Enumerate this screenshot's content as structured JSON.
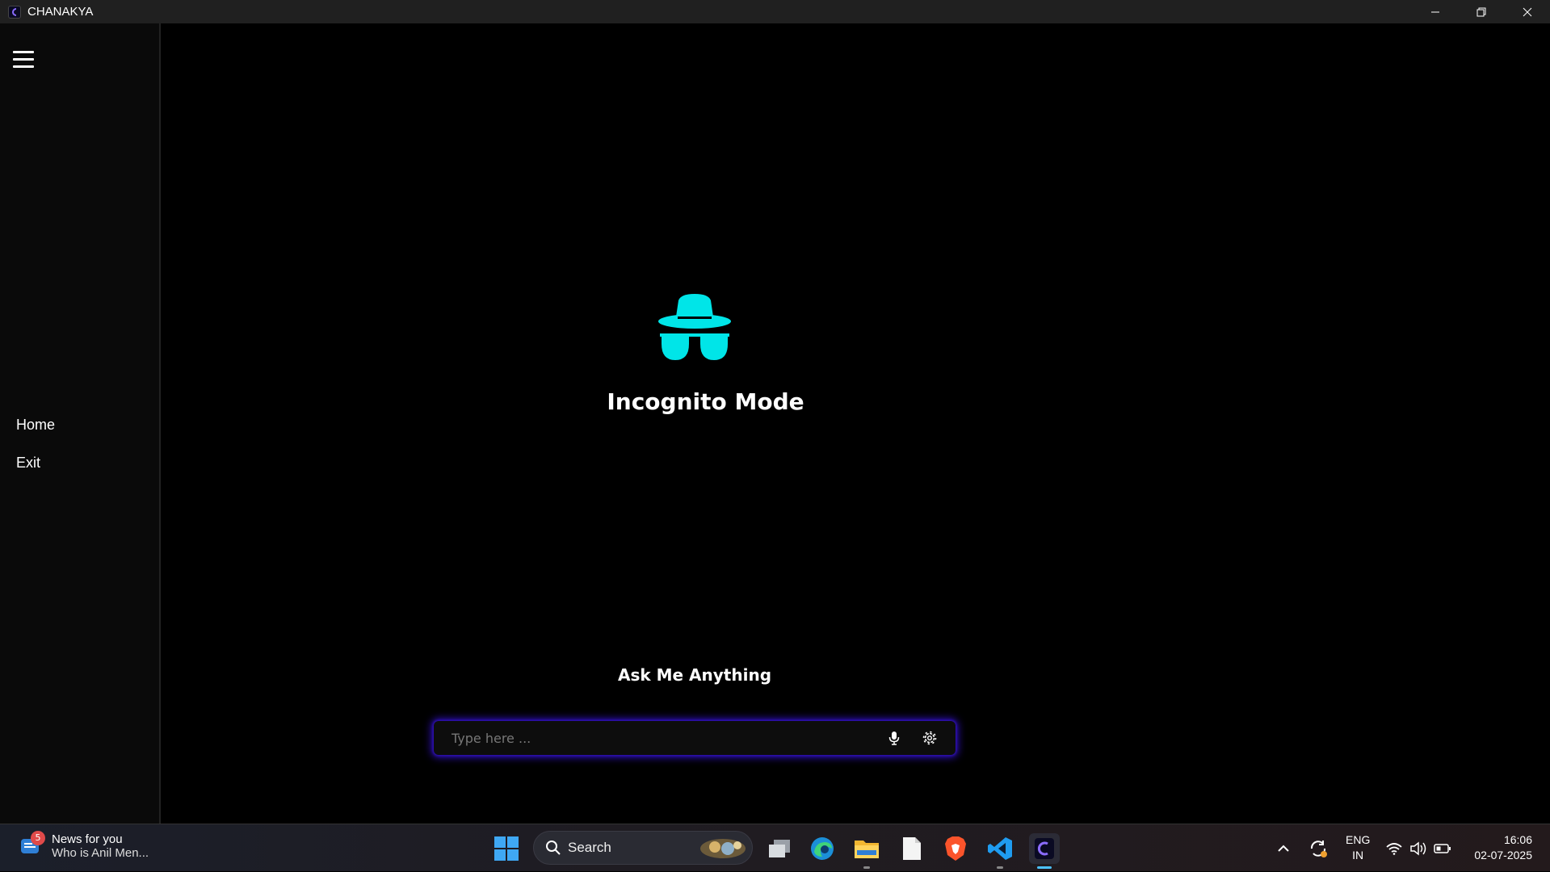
{
  "window": {
    "title": "CHANAKYA"
  },
  "sidebar": {
    "items": [
      {
        "label": "Home"
      },
      {
        "label": "Exit"
      }
    ]
  },
  "main": {
    "mode_title": "Incognito Mode",
    "ask_title": "Ask Me Anything",
    "input_placeholder": "Type here ...",
    "accent_color": "#00E5E8",
    "glow_color": "#2E0FB8"
  },
  "taskbar": {
    "news": {
      "badge_count": "5",
      "title": "News for you",
      "subtitle": "Who is Anil Men..."
    },
    "search_label": "Search",
    "apps": [
      "task-view",
      "edge",
      "file-explorer",
      "notepad",
      "brave",
      "vscode",
      "chanakya"
    ],
    "language": {
      "line1": "ENG",
      "line2": "IN"
    },
    "time": "16:06",
    "date": "02-07-2025"
  }
}
